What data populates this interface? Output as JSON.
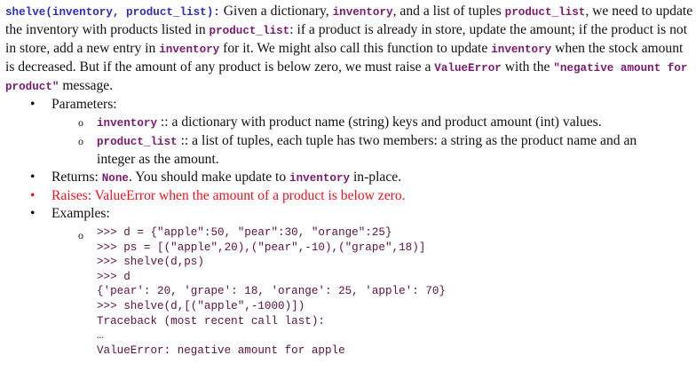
{
  "intro": {
    "signature": "shelve(inventory, product_list):",
    "t1": " Given a dictionary, ",
    "c1": "inventory",
    "t2": ", and a list of tuples ",
    "c2": "product_list",
    "t3": ", we need to update the inventory with products listed in ",
    "c3": "product_list",
    "t4": ": if a product is already in store, update the amount; if the product is not in store, add a new entry in ",
    "c4": "inventory",
    "t5": " for it.  We might also call this function to update ",
    "c5": "inventory",
    "t6": " when the stock amount is decreased.  But if the amount of any product is below zero, we must raise a ",
    "c6": "ValueError",
    "t7": " with the ",
    "c7": "\"negative amount for product\"",
    "t8": " message."
  },
  "parameters": {
    "label": "Parameters:",
    "items": [
      {
        "name": "inventory",
        "desc": " :: a dictionary with product name (string) keys and product amount (int) values."
      },
      {
        "name": "product_list",
        "desc": " :: a list of tuples, each tuple has two members: a string as the product name and an integer as the amount."
      }
    ]
  },
  "returns": {
    "label": "Returns: ",
    "value": "None",
    "t1": ".  You should make update to ",
    "c1": "inventory",
    "t2": " in-place."
  },
  "raises": "Raises: ValueError when the amount of a product is below zero.",
  "examples": {
    "label": "Examples:",
    "lines": [
      ">>> d = {\"apple\":50, \"pear\":30, \"orange\":25}",
      ">>> ps = [(\"apple\",20),(\"pear\",-10),(\"grape\",18)]",
      ">>> shelve(d,ps)",
      ">>> d",
      "{'pear': 20, 'grape': 18, 'orange': 25, 'apple': 70}",
      ">>> shelve(d,[(\"apple\",-1000)])",
      "Traceback (most recent call last):",
      "…",
      "ValueError: negative amount for apple"
    ]
  },
  "colors": {
    "code": "#7a1a6e",
    "signature": "#2d2db8",
    "raises": "#e8141e",
    "example": "#5c0f3e"
  }
}
